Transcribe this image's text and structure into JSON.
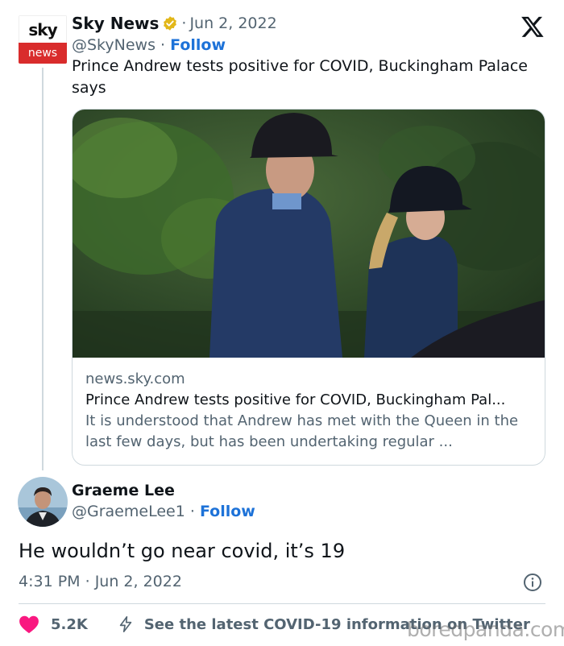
{
  "tweet": {
    "author_name": "Sky News",
    "date": "Jun 2, 2022",
    "handle": "@SkyNews",
    "follow_label": "Follow",
    "separator": "·",
    "text": "Prince Andrew tests positive for COVID, Buckingham Palace says",
    "avatar": {
      "top_text": "sky",
      "bottom_text": "news",
      "brand_color": "#d92c2c"
    }
  },
  "card": {
    "domain": "news.sky.com",
    "title": "Prince Andrew tests positive for COVID, Buckingham Pal...",
    "description": "It is understood that Andrew has met with the Queen in the last few days, but has been undertaking regular ..."
  },
  "reply": {
    "author_name": "Graeme Lee",
    "handle": "@GraemeLee1",
    "follow_label": "Follow",
    "text": "He wouldn’t go near covid, it’s 19",
    "time": "4:31 PM",
    "date": "Jun 2, 2022",
    "likes": "5.2K",
    "latest_info": "See the latest COVID-19 information on Twitter"
  },
  "watermark": "boredpanda.com",
  "colors": {
    "link": "#1d72d8",
    "muted": "#536471",
    "heart": "#f91880",
    "verified": "#e2b719"
  },
  "icons": [
    "x-logo-icon",
    "verified-badge-icon",
    "info-icon",
    "heart-icon",
    "lightning-icon"
  ]
}
